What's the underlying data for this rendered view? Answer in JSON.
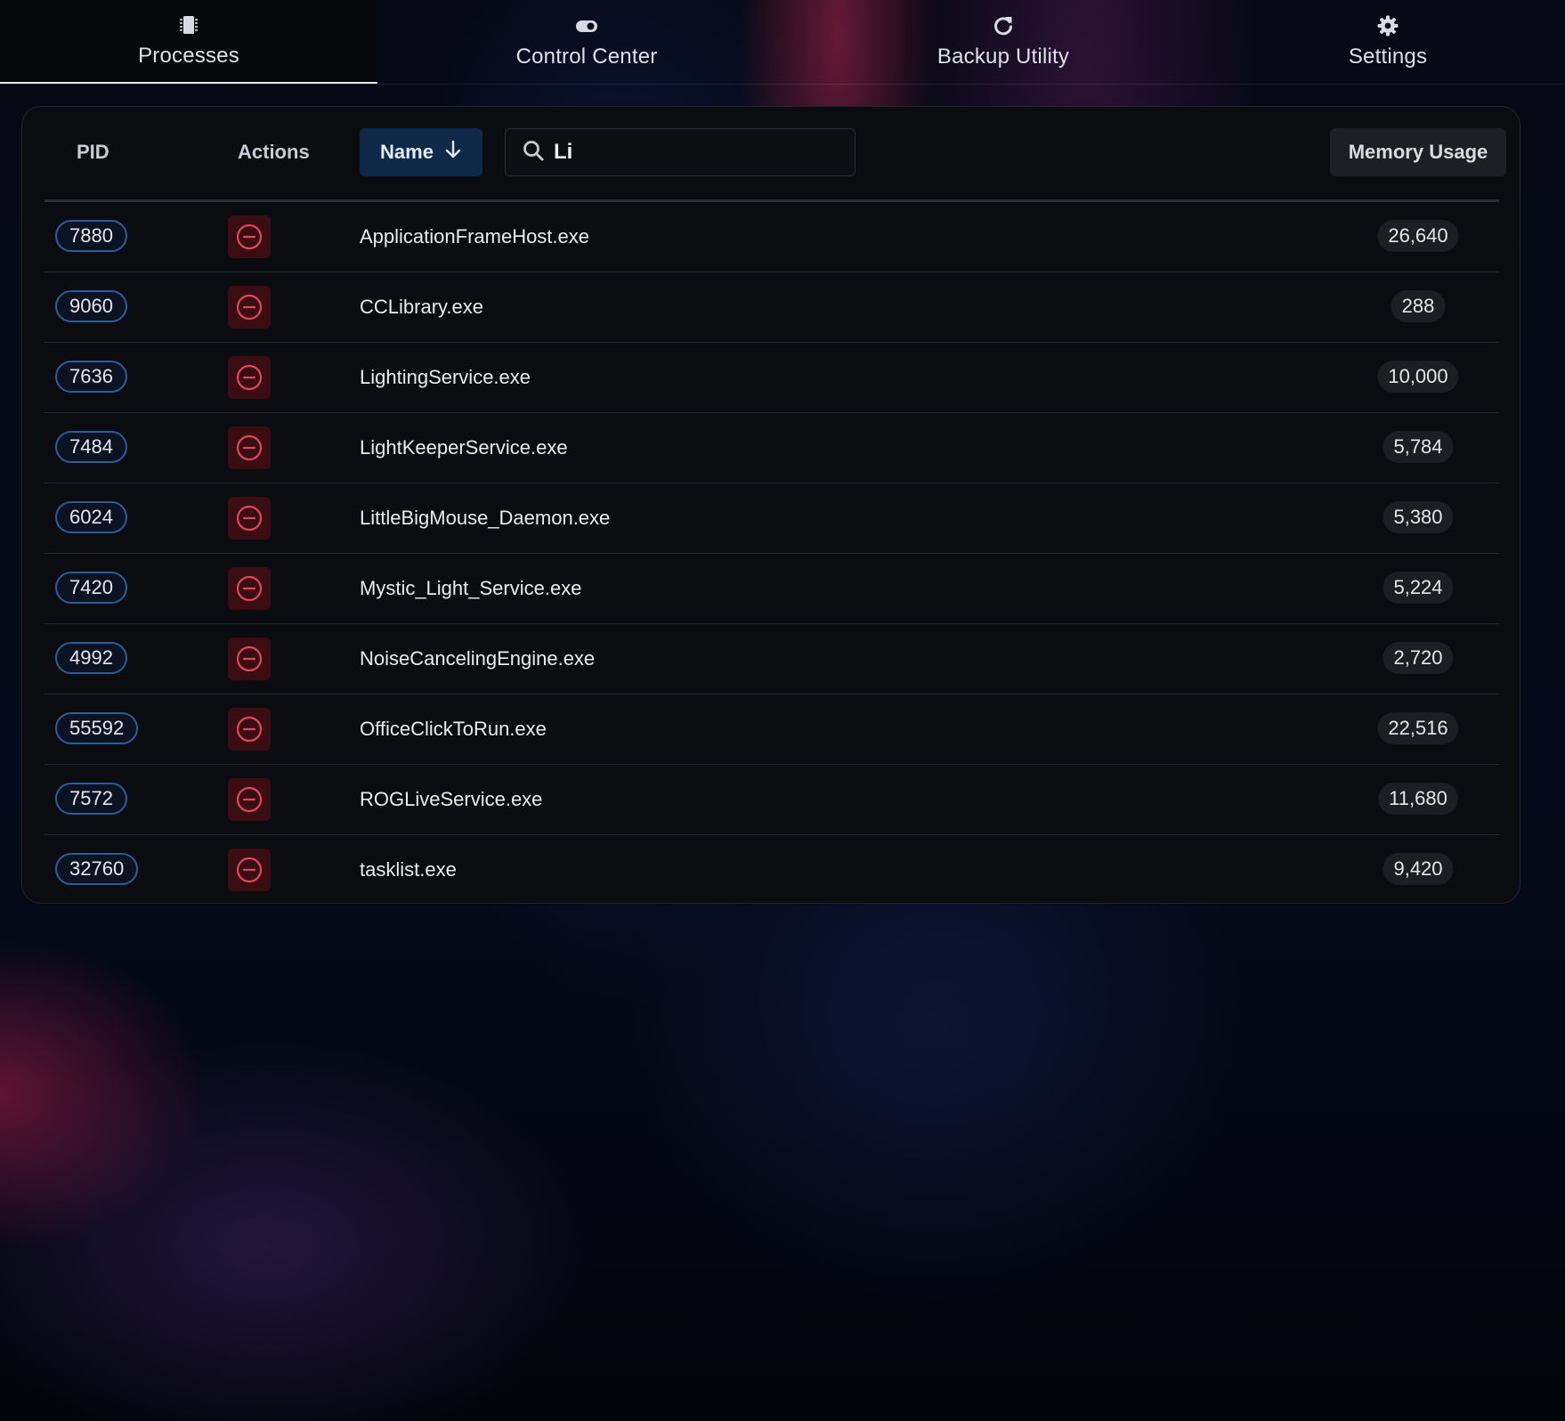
{
  "tabs": [
    {
      "label": "Processes",
      "icon": "chip-icon",
      "active": true
    },
    {
      "label": "Control Center",
      "icon": "toggle-icon",
      "active": false
    },
    {
      "label": "Backup Utility",
      "icon": "refresh-icon",
      "active": false
    },
    {
      "label": "Settings",
      "icon": "gear-icon",
      "active": false
    }
  ],
  "table": {
    "headers": {
      "pid": "PID",
      "actions": "Actions",
      "name": "Name",
      "memory": "Memory Usage"
    },
    "sort": {
      "column": "Name",
      "direction": "descending-arrow"
    },
    "search": {
      "value": "Li",
      "icon": "search-icon"
    },
    "rows": [
      {
        "pid": "7880",
        "name": "ApplicationFrameHost.exe",
        "memory": "26,640"
      },
      {
        "pid": "9060",
        "name": "CCLibrary.exe",
        "memory": "288"
      },
      {
        "pid": "7636",
        "name": "LightingService.exe",
        "memory": "10,000"
      },
      {
        "pid": "7484",
        "name": "LightKeeperService.exe",
        "memory": "5,784"
      },
      {
        "pid": "6024",
        "name": "LittleBigMouse_Daemon.exe",
        "memory": "5,380"
      },
      {
        "pid": "7420",
        "name": "Mystic_Light_Service.exe",
        "memory": "5,224"
      },
      {
        "pid": "4992",
        "name": "NoiseCancelingEngine.exe",
        "memory": "2,720"
      },
      {
        "pid": "55592",
        "name": "OfficeClickToRun.exe",
        "memory": "22,516"
      },
      {
        "pid": "7572",
        "name": "ROGLiveService.exe",
        "memory": "11,680"
      },
      {
        "pid": "32760",
        "name": "tasklist.exe",
        "memory": "9,420"
      }
    ]
  },
  "colors": {
    "accent_blue": "#2a5d9c",
    "kill_bg": "#3a0d12",
    "kill_icon": "#e0485a",
    "panel_bg": "#0b0c0f"
  }
}
